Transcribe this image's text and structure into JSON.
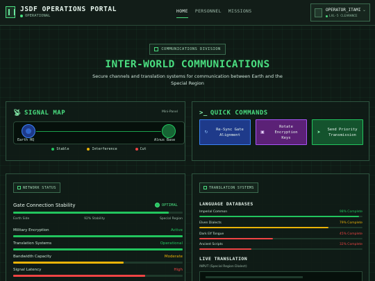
{
  "header": {
    "title": "JSDF OPERATIONS PORTAL",
    "status": "OPERATIONAL",
    "nav": [
      "HOME",
      "PERSONNEL",
      "MISSIONS"
    ],
    "user": {
      "name": "OPERATOR_ITAMI",
      "clearance": "LVL-5 CLEARANCE"
    }
  },
  "hero": {
    "badge": "COMMUNICATIONS DIVISION",
    "title": "INTER-WORLD COMMUNICATIONS",
    "description": "Secure channels and translation systems for communication between Earth and the Special Region"
  },
  "signal_map": {
    "title": "SIGNAL MAP",
    "mini_label": "Mini-Panel",
    "nodes": {
      "earth": "Earth HQ",
      "alnus": "Alnus Base"
    },
    "legend": [
      {
        "label": "Stable",
        "color": "#22c55e"
      },
      {
        "label": "Interference",
        "color": "#eab308"
      },
      {
        "label": "Cut",
        "color": "#ef4444"
      }
    ]
  },
  "quick_commands": {
    "title": "QUICK COMMANDS",
    "buttons": [
      {
        "label": "Re-Sync Gate Alignment",
        "icon": "sync-icon"
      },
      {
        "label": "Rotate Encryption Keys",
        "icon": "lock-icon"
      },
      {
        "label": "Send Priority Transmission",
        "icon": "send-icon"
      }
    ]
  },
  "network_status": {
    "tag": "NETWORK STATUS",
    "gate_label": "Gate Connection Stability",
    "gate_status": "OPTIMAL",
    "gate_value": 0.92,
    "earth_side": "Earth Side",
    "stability_text": "92% Stability",
    "special_region": "Special Region",
    "rows": [
      {
        "label": "Military Encryption",
        "status": "Active",
        "color": "#22c55e",
        "value": 1.0
      },
      {
        "label": "Translation Systems",
        "status": "Operational",
        "color": "#3b82f6",
        "value": 1.0
      },
      {
        "label": "Bandwidth Capacity",
        "status": "Moderate",
        "color": "#eab308",
        "value": 0.65
      },
      {
        "label": "Signal Latency",
        "status": "High",
        "color": "#ef4444",
        "value": 0.78
      }
    ]
  },
  "translation": {
    "tag": "TRANSLATION SYSTEMS",
    "databases_title": "LANGUAGE DATABASES",
    "languages": [
      {
        "name": "Imperial Common",
        "complete": "98% Complete",
        "value": 0.98,
        "color": "#22c55e"
      },
      {
        "name": "Elven Dialects",
        "complete": "79% Complete",
        "value": 0.79,
        "color": "#eab308"
      },
      {
        "name": "Dark Elf Tongue",
        "complete": "45% Complete",
        "value": 0.45,
        "color": "#ef4444"
      },
      {
        "name": "Ancient Scripts",
        "complete": "32% Complete",
        "value": 0.32,
        "color": "#ef4444"
      }
    ],
    "live_title": "LIVE TRANSLATION",
    "input_label": "INPUT (Special Region Dialect)"
  }
}
